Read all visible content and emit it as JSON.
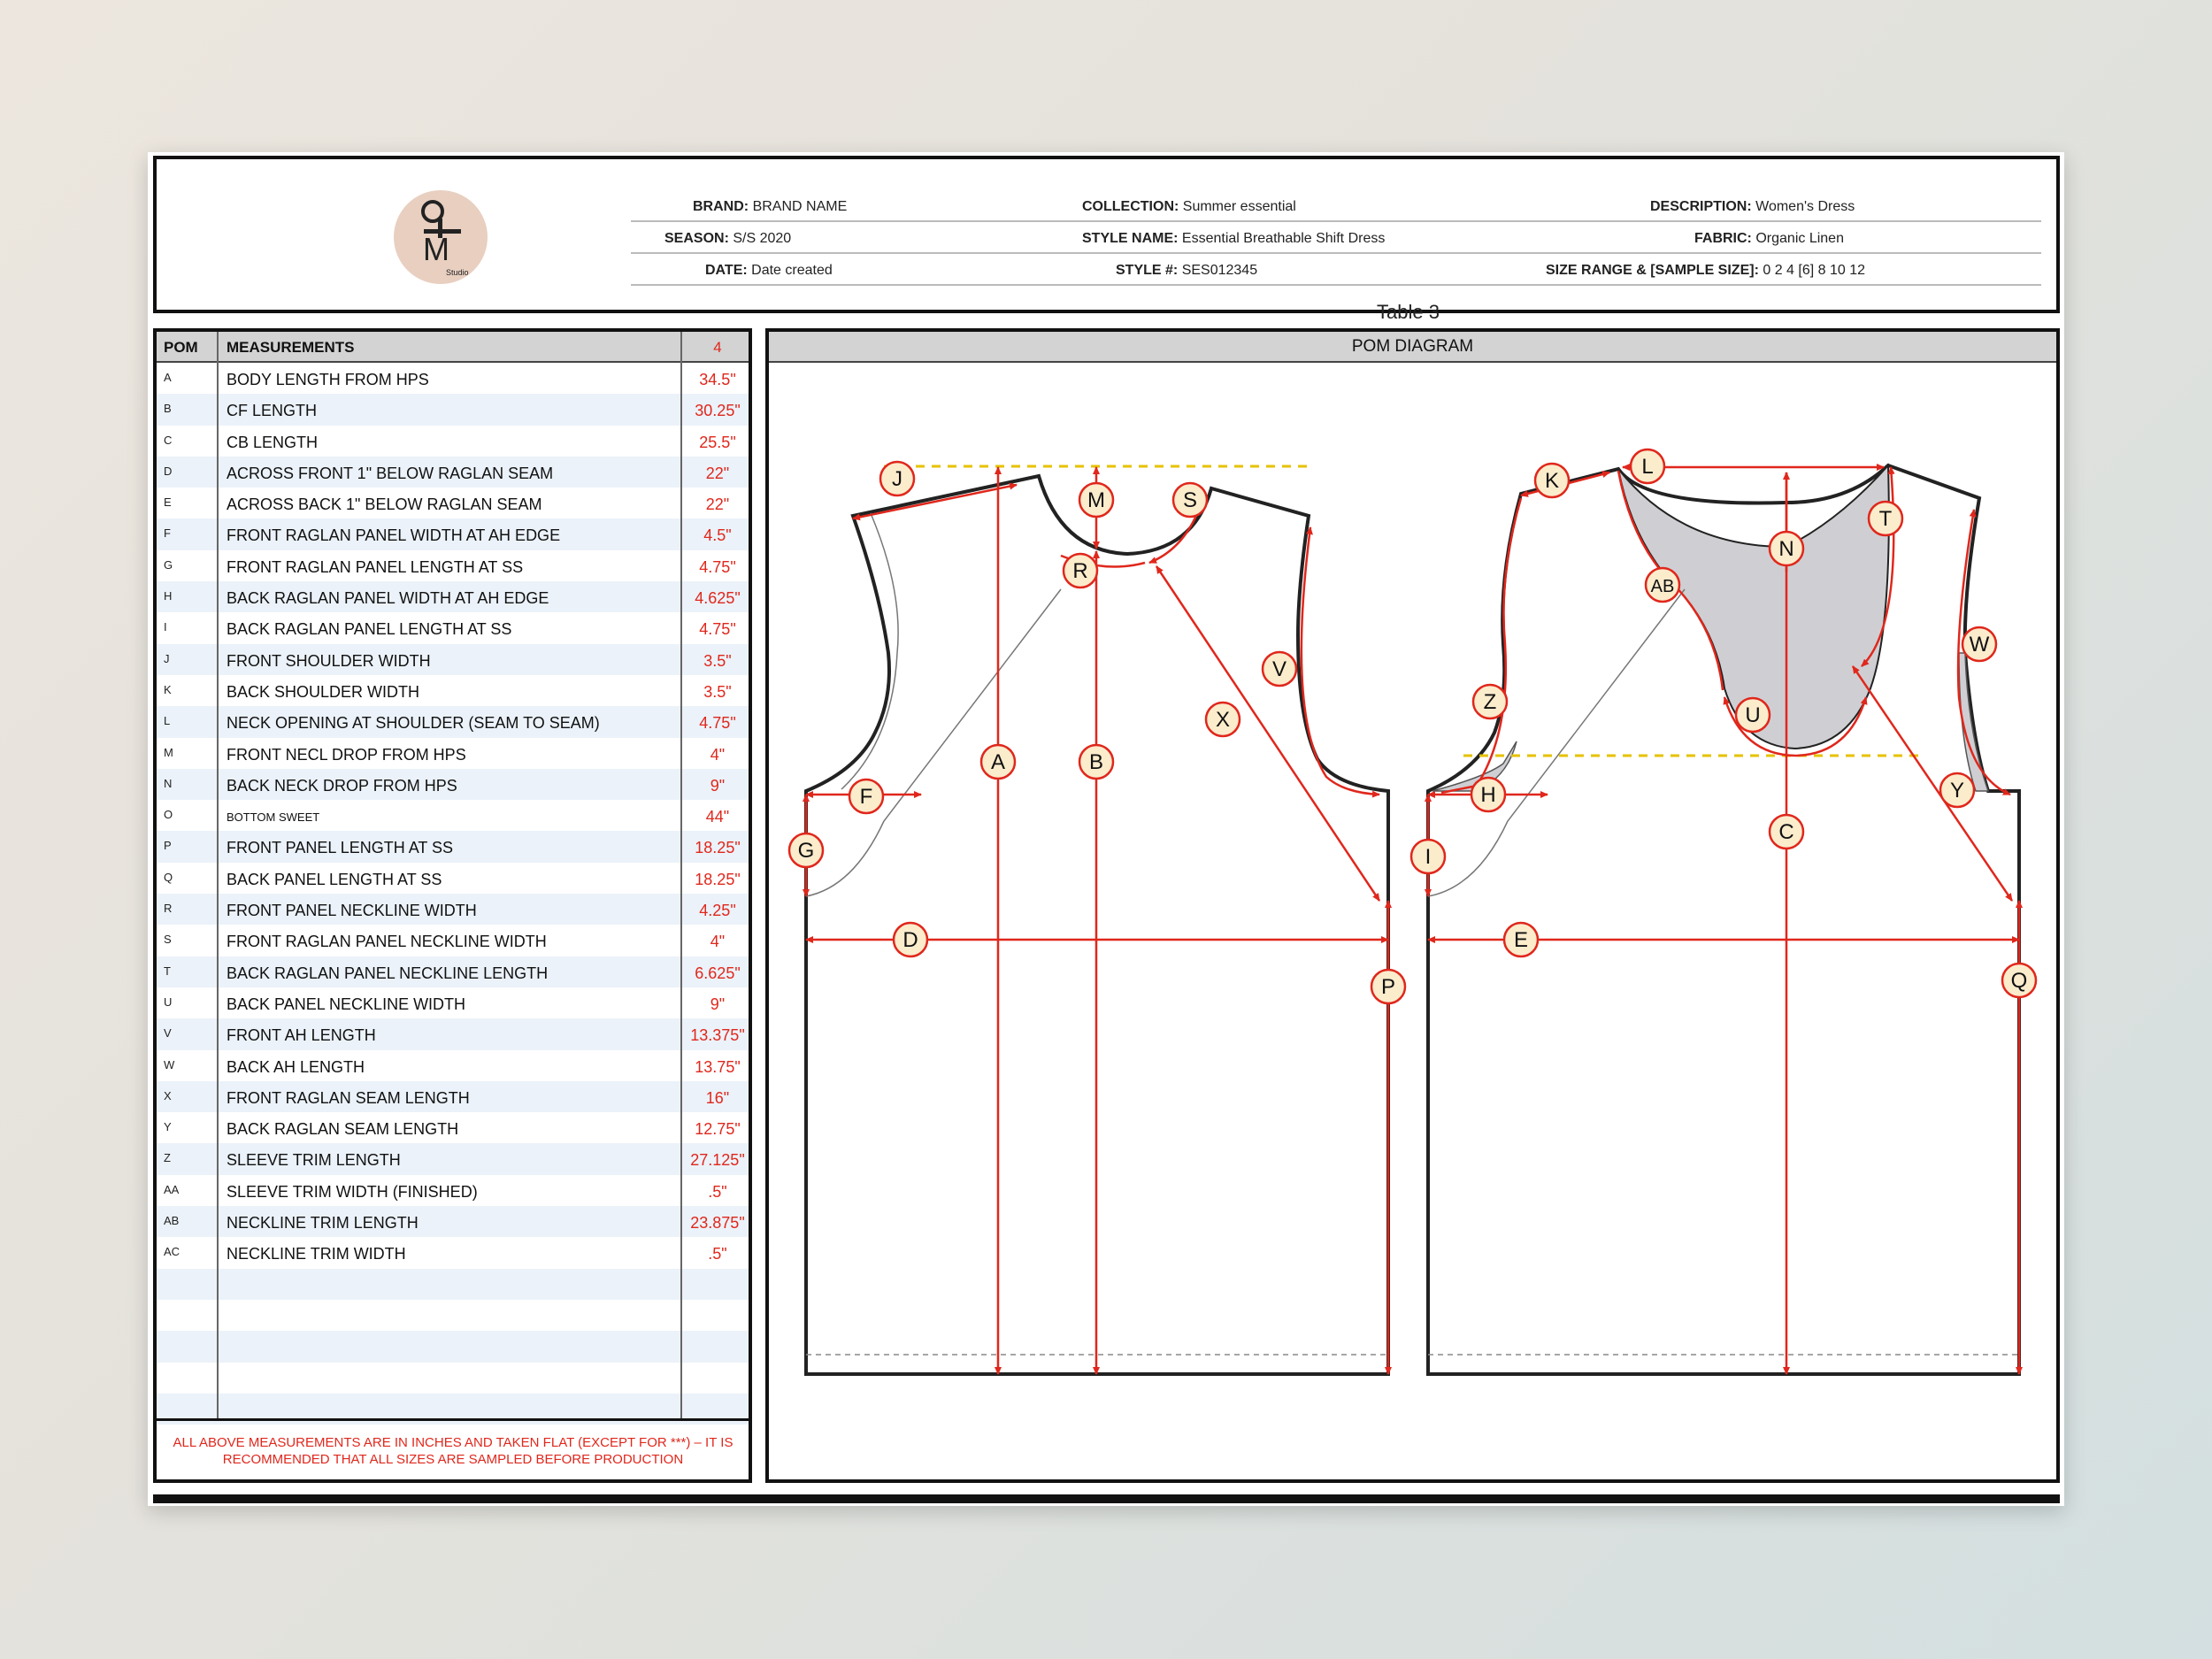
{
  "header": {
    "brand_label": "BRAND:",
    "brand": "BRAND NAME",
    "collection_label": "COLLECTION:",
    "collection": "Summer essential",
    "description_label": "DESCRIPTION:",
    "description": "Women's Dress",
    "season_label": "SEASON:",
    "season": "S/S 2020",
    "style_name_label": "STYLE NAME:",
    "style_name": "Essential Breathable Shift Dress",
    "fabric_label": "FABRIC:",
    "fabric": "Organic Linen",
    "date_label": "DATE:",
    "date": "Date created",
    "style_no_label": "STYLE #:",
    "style_no": "SES012345",
    "size_range_label": "SIZE RANGE & [SAMPLE SIZE]:",
    "size_range": "0 2  4  [6]  8  10  12"
  },
  "logo": {
    "letter": "M",
    "caption": "Studio"
  },
  "table_caption": "Table 3",
  "table": {
    "headers": {
      "pom": "POM",
      "measurements": "MEASUREMENTS",
      "size": "4"
    },
    "rows": [
      {
        "pom": "A",
        "measurement": "BODY LENGTH FROM HPS",
        "value": "34.5\""
      },
      {
        "pom": "B",
        "measurement": "CF LENGTH",
        "value": "30.25\""
      },
      {
        "pom": "C",
        "measurement": "CB LENGTH",
        "value": "25.5\""
      },
      {
        "pom": "D",
        "measurement": "ACROSS FRONT 1\" BELOW RAGLAN SEAM",
        "value": "22\""
      },
      {
        "pom": "E",
        "measurement": "ACROSS BACK 1\" BELOW RAGLAN SEAM",
        "value": "22\""
      },
      {
        "pom": "F",
        "measurement": "FRONT RAGLAN PANEL WIDTH AT AH EDGE",
        "value": "4.5\""
      },
      {
        "pom": "G",
        "measurement": "FRONT RAGLAN PANEL LENGTH AT SS",
        "value": "4.75\""
      },
      {
        "pom": "H",
        "measurement": "BACK RAGLAN PANEL WIDTH AT AH EDGE",
        "value": "4.625\""
      },
      {
        "pom": "I",
        "measurement": "BACK RAGLAN PANEL LENGTH AT SS",
        "value": "4.75\""
      },
      {
        "pom": "J",
        "measurement": "FRONT SHOULDER WIDTH",
        "value": "3.5\""
      },
      {
        "pom": "K",
        "measurement": "BACK SHOULDER WIDTH",
        "value": "3.5\""
      },
      {
        "pom": "L",
        "measurement": "NECK OPENING AT SHOULDER (SEAM TO SEAM)",
        "value": "4.75\""
      },
      {
        "pom": "M",
        "measurement": "FRONT NECL DROP FROM HPS",
        "value": "4\""
      },
      {
        "pom": "N",
        "measurement": "BACK NECK DROP FROM HPS",
        "value": "9\""
      },
      {
        "pom": "O",
        "measurement": "BOTTOM SWEET",
        "value": "44\""
      },
      {
        "pom": "P",
        "measurement": "FRONT PANEL LENGTH AT SS",
        "value": "18.25\""
      },
      {
        "pom": "Q",
        "measurement": "BACK PANEL LENGTH AT SS",
        "value": "18.25\""
      },
      {
        "pom": "R",
        "measurement": "FRONT PANEL NECKLINE WIDTH",
        "value": "4.25\""
      },
      {
        "pom": "S",
        "measurement": "FRONT RAGLAN PANEL NECKLINE WIDTH",
        "value": "4\""
      },
      {
        "pom": "T",
        "measurement": "BACK RAGLAN PANEL NECKLINE LENGTH",
        "value": "6.625\""
      },
      {
        "pom": "U",
        "measurement": "BACK PANEL NECKLINE WIDTH",
        "value": "9\""
      },
      {
        "pom": "V",
        "measurement": "FRONT AH LENGTH",
        "value": "13.375\""
      },
      {
        "pom": "W",
        "measurement": "BACK AH LENGTH",
        "value": "13.75\""
      },
      {
        "pom": "X",
        "measurement": "FRONT RAGLAN SEAM LENGTH",
        "value": "16\""
      },
      {
        "pom": "Y",
        "measurement": "BACK RAGLAN SEAM LENGTH",
        "value": "12.75\""
      },
      {
        "pom": "Z",
        "measurement": "SLEEVE TRIM LENGTH",
        "value": "27.125\""
      },
      {
        "pom": "AA",
        "measurement": "SLEEVE TRIM WIDTH (FINISHED)",
        "value": ".5\""
      },
      {
        "pom": "AB",
        "measurement": "NECKLINE TRIM LENGTH",
        "value": "23.875\""
      },
      {
        "pom": "AC",
        "measurement": "NECKLINE TRIM WIDTH",
        "value": ".5\""
      },
      {
        "pom": "",
        "measurement": "",
        "value": ""
      },
      {
        "pom": "",
        "measurement": "",
        "value": ""
      },
      {
        "pom": "",
        "measurement": "",
        "value": ""
      },
      {
        "pom": "",
        "measurement": "",
        "value": ""
      },
      {
        "pom": "",
        "measurement": "",
        "value": ""
      },
      {
        "pom": "",
        "measurement": "",
        "value": ""
      }
    ],
    "footnote": "ALL ABOVE MEASUREMENTS ARE IN INCHES AND TAKEN FLAT (EXCEPT FOR ***) – IT IS RECOMMENDED THAT ALL SIZES ARE SAMPLED BEFORE PRODUCTION"
  },
  "diagram": {
    "title": "POM DIAGRAM",
    "front_markers": [
      "J",
      "M",
      "S",
      "R",
      "V",
      "A",
      "B",
      "X",
      "F",
      "G",
      "D",
      "P"
    ],
    "back_markers": [
      "K",
      "L",
      "T",
      "AB",
      "N",
      "W",
      "Z",
      "U",
      "H",
      "I",
      "C",
      "Y",
      "E",
      "Q"
    ]
  },
  "colors": {
    "measure_red": "#e0271c",
    "marker_fill": "#fbeccc",
    "guide_yellow": "#e6c200",
    "trim_gray": "#cfcfd3"
  }
}
